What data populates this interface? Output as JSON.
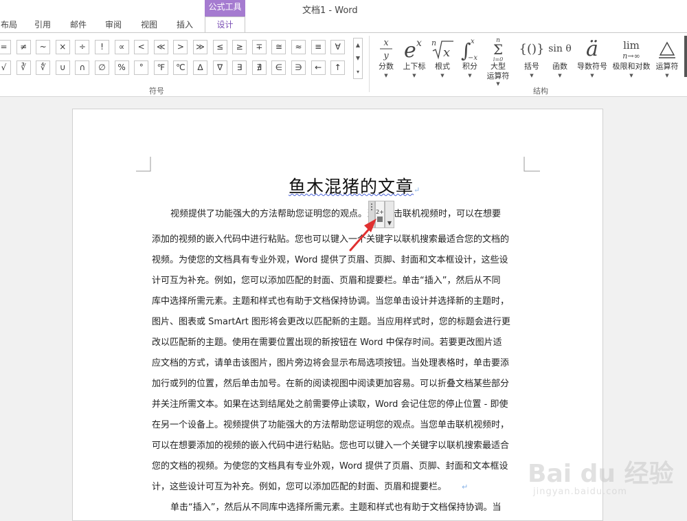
{
  "window": {
    "title": "文档1 - Word",
    "context_tab": "公式工具"
  },
  "tabs": [
    {
      "label": "布局",
      "active": false
    },
    {
      "label": "引用",
      "active": false
    },
    {
      "label": "邮件",
      "active": false
    },
    {
      "label": "审阅",
      "active": false
    },
    {
      "label": "视图",
      "active": false
    },
    {
      "label": "插入",
      "active": false
    },
    {
      "label": "设计",
      "active": true
    }
  ],
  "ribbon": {
    "symbols_group_label": "符号",
    "structure_group_label": "结构",
    "symbols_row1": [
      "=",
      "≠",
      "~",
      "×",
      "÷",
      "!",
      "∝",
      "<",
      "≪",
      ">",
      "≫",
      "≤",
      "≥",
      "∓",
      "≅",
      "≈",
      "≡",
      "∀"
    ],
    "symbols_row2": [
      "√",
      "∛",
      "∜",
      "∪",
      "∩",
      "∅",
      "%",
      "°",
      "℉",
      "℃",
      "∆",
      "∇",
      "∃",
      "∄",
      "∈",
      "∋",
      "←",
      "↑"
    ],
    "structures": [
      {
        "label": "分数",
        "label2": "",
        "glyph": "x/y",
        "icon": "fraction-icon"
      },
      {
        "label": "上下标",
        "label2": "",
        "glyph": "e^x",
        "icon": "script-icon"
      },
      {
        "label": "根式",
        "label2": "",
        "glyph": "ⁿ√x",
        "icon": "radical-icon"
      },
      {
        "label": "积分",
        "label2": "",
        "glyph": "∫",
        "icon": "integral-icon"
      },
      {
        "label": "大型",
        "label2": "运算符",
        "glyph": "Σ",
        "icon": "large-operator-icon"
      },
      {
        "label": "括号",
        "label2": "",
        "glyph": "{()}",
        "icon": "bracket-icon"
      },
      {
        "label": "函数",
        "label2": "",
        "glyph": "sin θ",
        "icon": "function-icon"
      },
      {
        "label": "导数符号",
        "label2": "",
        "glyph": "ä",
        "icon": "accent-icon"
      },
      {
        "label": "极限和对数",
        "label2": "",
        "glyph": "lim",
        "icon": "limit-icon"
      },
      {
        "label": "运算符",
        "label2": "",
        "glyph": "△",
        "icon": "operator-icon"
      }
    ]
  },
  "document": {
    "heading": "鱼木混猪的文章",
    "lines": [
      "视频提供了功能强大的方法帮助您证明您的观点。当您单击联机视频时，可以在想要",
      "添加的视频的嵌入代码中进行粘贴。您也可以键入一个关键字以联机搜索最适合您的文档的",
      "视频。为使您的文档具有专业外观，Word 提供了页眉、页脚、封面和文本框设计，这些设",
      "计可互为补充。例如，您可以添加匹配的封面、页眉和提要栏。单击“插入”，然后从不同",
      "库中选择所需元素。主题和样式也有助于文档保持协调。当您单击设计并选择新的主题时，",
      "图片、图表或 SmartArt 图形将会更改以匹配新的主题。当应用样式时，您的标题会进行更",
      "改以匹配新的主题。使用在需要位置出现的新按钮在 Word 中保存时间。若要更改图片适",
      "应文档的方式，请单击该图片，图片旁边将会显示布局选项按钮。当处理表格时，单击要添",
      "加行或列的位置，然后单击加号。在新的阅读视图中阅读更加容易。可以折叠文档某些部分",
      "并关注所需文本。如果在达到结尾处之前需要停止读取，Word 会记住您的停止位置 - 即使",
      "在另一个设备上。视频提供了功能强大的方法帮助您证明您的观点。当您单击联机视频时，",
      "可以在想要添加的视频的嵌入代码中进行粘贴。您也可以键入一个关键字以联机搜索最适合",
      "您的文档的视频。为使您的文档具有专业外观，Word 提供了页眉、页脚、封面和文本框设",
      "计，这些设计可互为补充。例如，您可以添加匹配的封面、页眉和提要栏。",
      "单击“插入”，然后从不同库中选择所需元素。主题和样式也有助于文档保持协调。当"
    ],
    "paragraph_mark": "↵"
  },
  "watermark": {
    "logo": "Bai du 经验",
    "sub": "jingyan.baidu.com"
  }
}
